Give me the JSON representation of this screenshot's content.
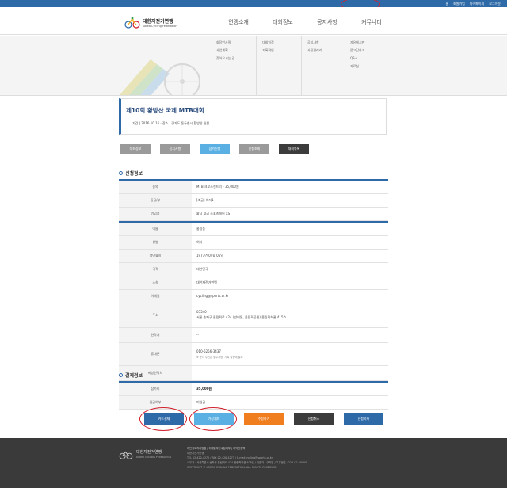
{
  "top_links": [
    "홈",
    "회원가입",
    "마이페이지",
    "로그아웃"
  ],
  "logo": {
    "kor": "대한자전거연맹",
    "eng": "Korea Cycling Federation"
  },
  "gnb": [
    "연맹소개",
    "대회정보",
    "공지사항",
    "커뮤니티"
  ],
  "submenu": {
    "col1": [
      "회장인사말",
      "사업계획",
      "찾아오시는 길"
    ],
    "col2": [
      "대회일정",
      "기록확인"
    ],
    "col3": [
      "공지사항",
      "사진갤러리"
    ],
    "col4": [
      "자유게시판",
      "묻고답하기",
      "Q&A",
      "자료실"
    ]
  },
  "event": {
    "title": "제10회 황방산 국제 MTB대회",
    "meta": "기간 | 2016.10.16 · 장소 | 경기도 동두천시 황방산 일원"
  },
  "tabs": [
    "대회정보",
    "공지사항",
    "참가신청",
    "신청조회",
    "대회목록"
  ],
  "sections": {
    "apply": "신청정보",
    "payment": "결제정보"
  },
  "event_info": [
    {
      "label": "종목",
      "value": "MTB 크로스컨트리 - 35,000원"
    },
    {
      "label": "등급/부",
      "value": "[초급] 여자1"
    },
    {
      "label": "기념품",
      "value": "황금 고급 스포츠에어 XS"
    }
  ],
  "personal_info": [
    {
      "label": "이름",
      "value": "홍길동"
    },
    {
      "label": "성별",
      "value": "여자"
    },
    {
      "label": "생년월일",
      "value": "1977년 04월 05일"
    },
    {
      "label": "국적",
      "value": "대한민국"
    },
    {
      "label": "소속",
      "value": "대한자전거연맹"
    },
    {
      "label": "이메일",
      "value": "cycling@sports.or.kr"
    },
    {
      "label": "주소",
      "value": "05540",
      "value2": "서울 송파구 올림픽로 424 (방이동, 올림픽공원) 올림픽회관 415호"
    },
    {
      "label": "연락처",
      "value": "--"
    },
    {
      "label": "휴대폰",
      "value": "010-5256-3437",
      "sub": "※ 문자 수신은 필수사항, 기록 발송에 필요"
    },
    {
      "label": "비상연락처",
      "value": ""
    }
  ],
  "payment_info": [
    {
      "label": "참가비",
      "value": "35,000원"
    },
    {
      "label": "입금여부",
      "value": "미입금"
    }
  ],
  "actions": [
    {
      "label": "카드결제",
      "color": "#2f6aa8"
    },
    {
      "label": "가상계좌",
      "color": "#5ab0e2"
    },
    {
      "label": "수정하기",
      "color": "#f07e1e"
    },
    {
      "label": "신청취소",
      "color": "#3c3c3c"
    },
    {
      "label": "신청목록",
      "color": "#2f6aa8"
    }
  ],
  "footer": {
    "logo_kor": "대한자전거연맹",
    "logo_eng": "KOREA CYCLING FEDERATION",
    "links": "개인정보처리방침 | 이메일무단수집거부 | 저작권정책",
    "org": "대한자전거연맹",
    "tel": "TEL 02-420-4272 / FAX 02-420-4273 / E-mail cycling@sports.or.kr",
    "addr": "사무처 : 서울특별시 송파구 올림픽로 424 올림픽회관 408호 / 대표자 : 구자열 / 고유번호 : 215-82-00000",
    "copy": "COPYRIGHT © KOREA CYCLING FEDERATION. ALL RIGHTS RESERVED."
  }
}
